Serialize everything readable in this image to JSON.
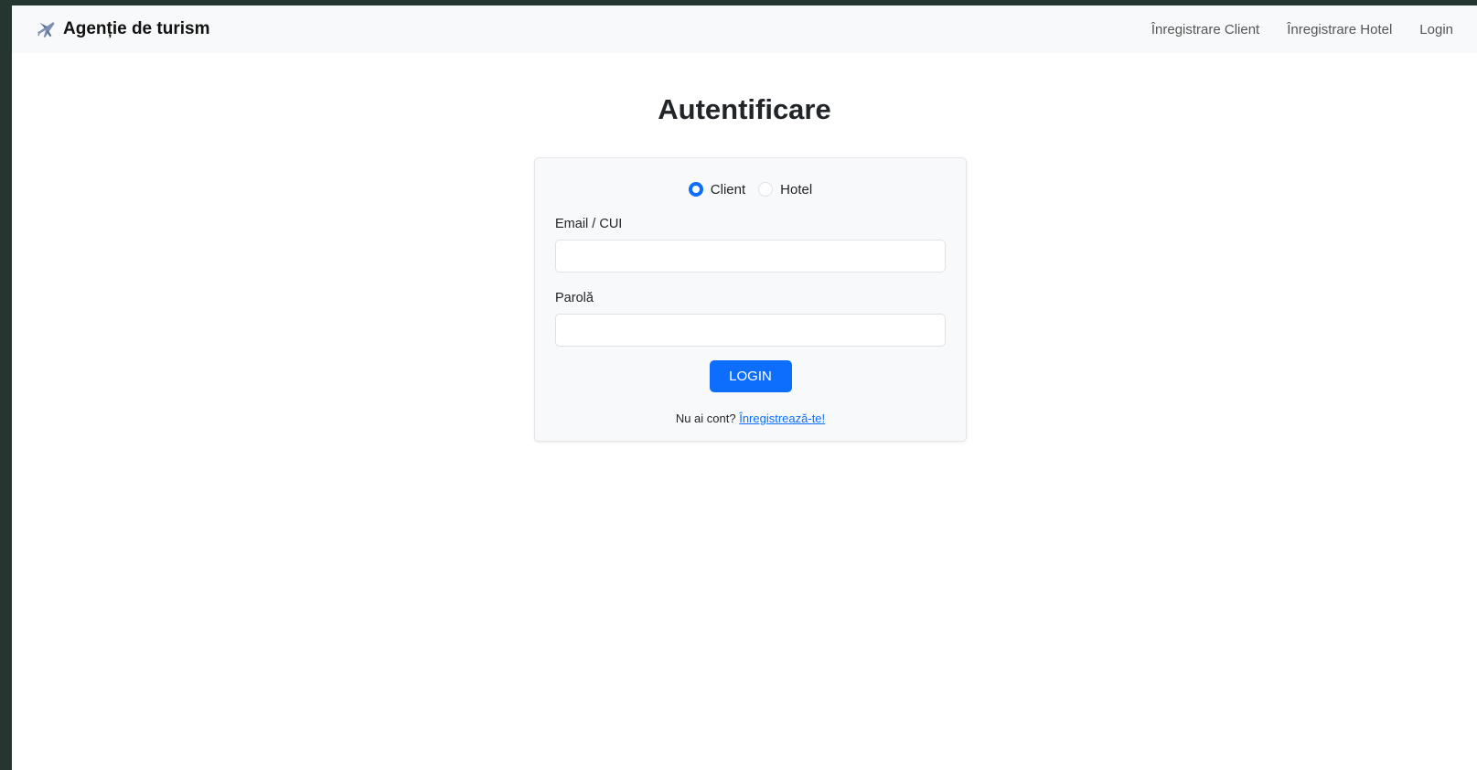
{
  "navbar": {
    "brand": "Agenție de turism",
    "brand_icon": "airplane-icon",
    "links": [
      "Înregistrare Client",
      "Înregistrare Hotel",
      "Login"
    ]
  },
  "page": {
    "title": "Autentificare"
  },
  "form": {
    "account_types": [
      {
        "label": "Client",
        "checked": true
      },
      {
        "label": "Hotel",
        "checked": false
      }
    ],
    "email_label": "Email / CUI",
    "email_value": "",
    "password_label": "Parolă",
    "password_value": "",
    "submit_label": "LOGIN",
    "register_prompt": "Nu ai cont?",
    "register_link": "Înregistrează-te!"
  },
  "colors": {
    "accent": "#0d6efd",
    "navbar_bg": "#f8f9fa",
    "card_bg": "#f8f9fa",
    "outer_bg": "#253530"
  }
}
